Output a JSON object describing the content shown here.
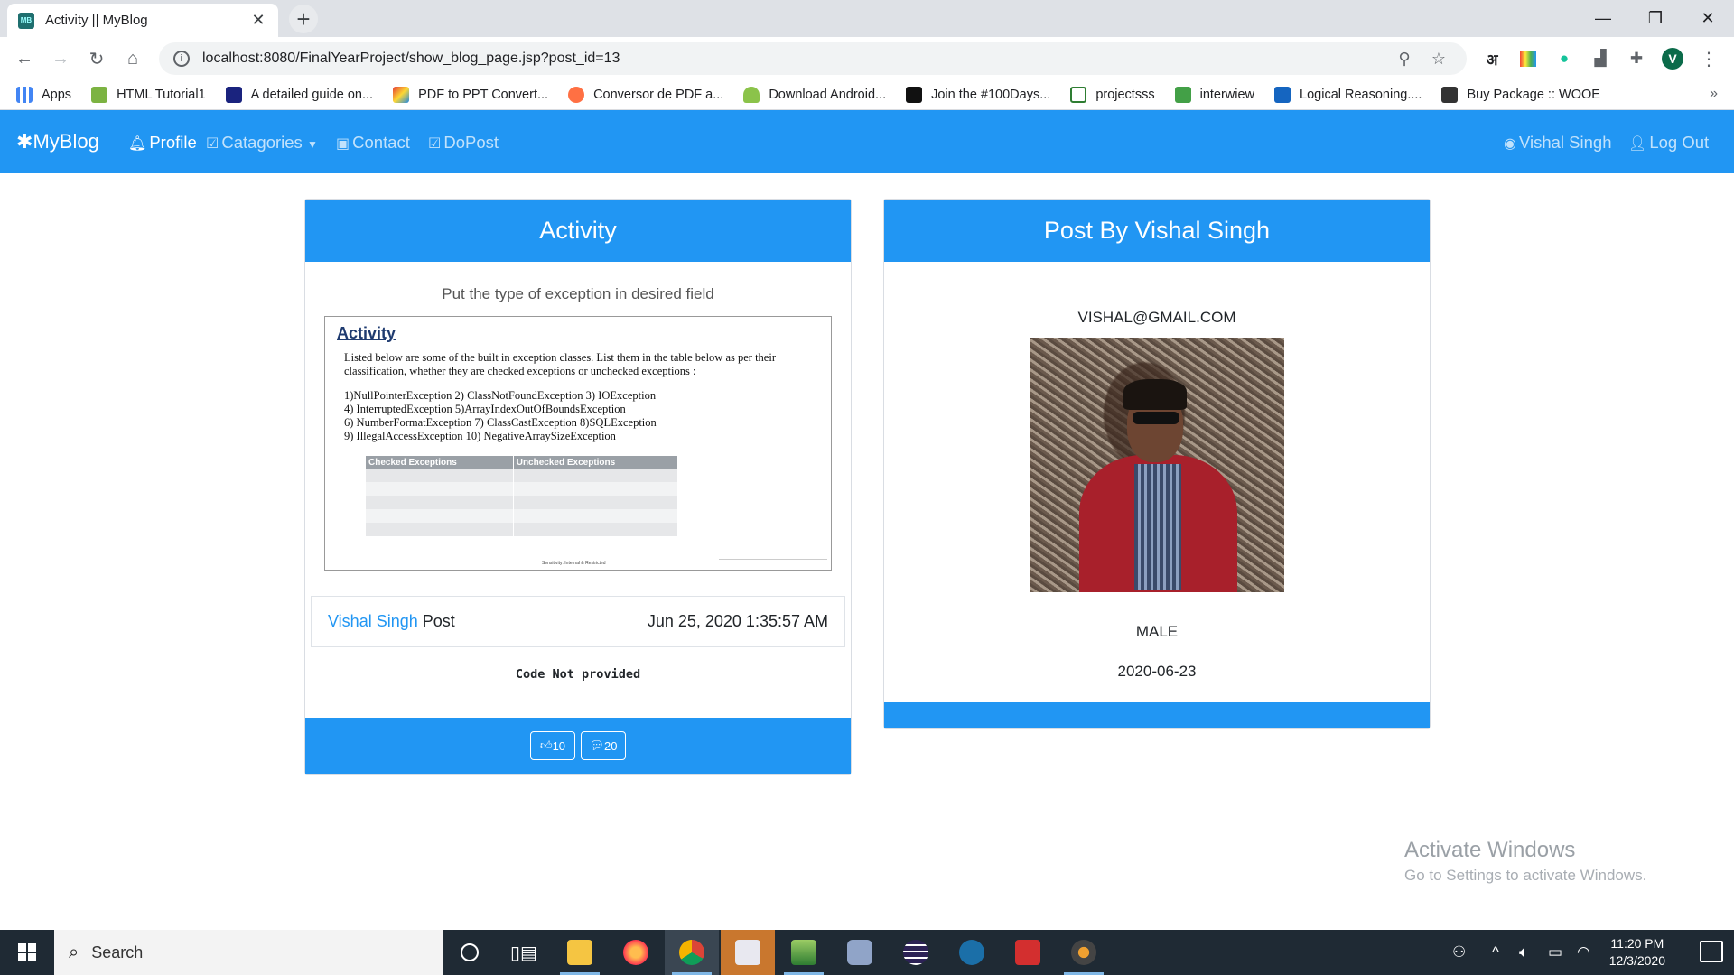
{
  "browser": {
    "tab_title": "Activity || MyBlog",
    "url": "localhost:8080/FinalYearProject/show_blog_page.jsp?post_id=13",
    "profile_initial": "V",
    "ext_letter": "अ"
  },
  "bookmarks": [
    {
      "label": "Apps",
      "color": "#4285f4"
    },
    {
      "label": "HTML Tutorial1",
      "color": "#7cb342"
    },
    {
      "label": "A detailed guide on...",
      "color": "#1a237e"
    },
    {
      "label": "PDF to PPT Convert...",
      "color": "#e53935"
    },
    {
      "label": "Conversor de PDF a...",
      "color": "#ff7043"
    },
    {
      "label": "Download Android...",
      "color": "#8bc34a"
    },
    {
      "label": "Join the #100Days...",
      "color": "#111111"
    },
    {
      "label": "projectsss",
      "color": "#2e7d32"
    },
    {
      "label": "interwiew",
      "color": "#43a047"
    },
    {
      "label": "Logical Reasoning....",
      "color": "#1565c0"
    },
    {
      "label": "Buy Package :: WOOE",
      "color": "#333333"
    }
  ],
  "nav": {
    "brand": "MyBlog",
    "profile": "Profile",
    "categories": "Catagories",
    "contact": "Contact",
    "dopost": "DoPost",
    "user": "Vishal Singh",
    "logout": "Log Out"
  },
  "post": {
    "header": "Activity",
    "subtitle": "Put the type of exception in desired field",
    "image": {
      "title": "Activity",
      "text": "Listed below are some of the built in exception classes. List them in the table below as per their classification, whether they are checked exceptions or unchecked exceptions :",
      "list": [
        "1)NullPointerException 2) ClassNotFoundException 3) IOException",
        "4) InterruptedException 5)ArrayIndexOutOfBoundsException",
        "6) NumberFormatException 7)  ClassCastException 8)SQLException",
        "9) IllegalAccessException 10) NegativeArraySizeException"
      ],
      "col1": "Checked Exceptions",
      "col2": "Unchecked Exceptions",
      "footer": "Sensitivity: Internal & Restricted"
    },
    "author": "Vishal Singh",
    "author_suffix": "Post",
    "date": "Jun 25, 2020 1:35:57 AM",
    "code": "Code Not provided",
    "likes": "10",
    "comments": "20"
  },
  "profile": {
    "header": "Post By Vishal Singh",
    "email": "VISHAL@GMAIL.COM",
    "gender": "MALE",
    "date": "2020-06-23"
  },
  "watermark": {
    "title": "Activate Windows",
    "sub": "Go to Settings to activate Windows."
  },
  "taskbar": {
    "search": "Search",
    "time": "11:20 PM",
    "date": "12/3/2020"
  }
}
